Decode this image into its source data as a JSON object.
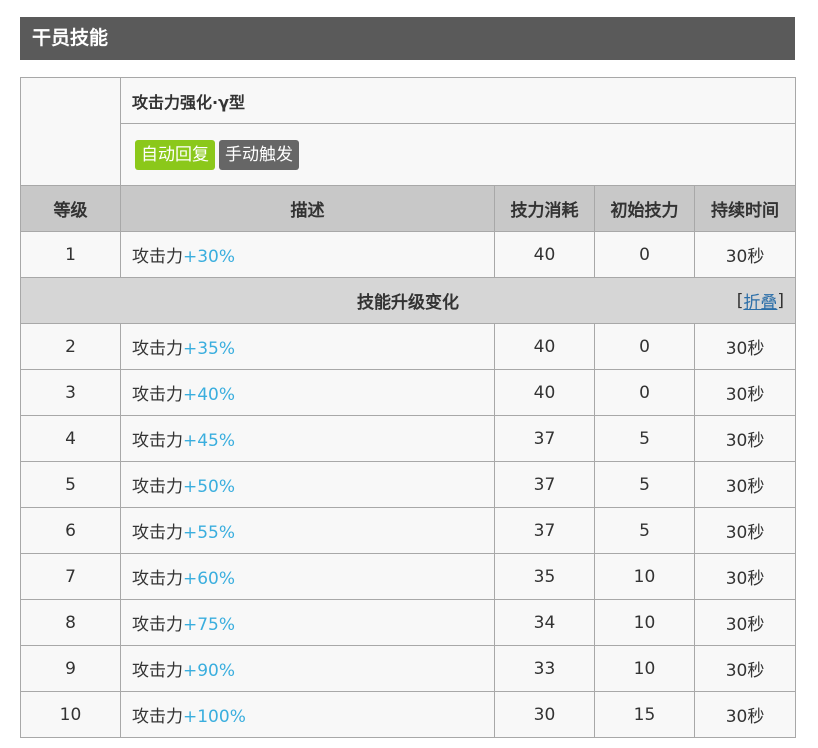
{
  "section": {
    "title": "干员技能"
  },
  "skill": {
    "name": "攻击力强化·γ型",
    "tags": [
      {
        "label": "自动回复",
        "color": "#8bc81a"
      },
      {
        "label": "手动触发",
        "color": "#666666"
      }
    ]
  },
  "columns": {
    "level": "等级",
    "description": "描述",
    "sp_cost": "技力消耗",
    "initial_sp": "初始技力",
    "duration": "持续时间"
  },
  "upgrade": {
    "title": "技能升级变化",
    "toggle_open": "[",
    "toggle_label": "折叠",
    "toggle_close": "]"
  },
  "rows": [
    {
      "level": "1",
      "desc_prefix": "攻击力",
      "desc_value": "+30%",
      "sp_cost": "40",
      "initial_sp": "0",
      "duration": "30秒"
    },
    {
      "level": "2",
      "desc_prefix": "攻击力",
      "desc_value": "+35%",
      "sp_cost": "40",
      "initial_sp": "0",
      "duration": "30秒"
    },
    {
      "level": "3",
      "desc_prefix": "攻击力",
      "desc_value": "+40%",
      "sp_cost": "40",
      "initial_sp": "0",
      "duration": "30秒"
    },
    {
      "level": "4",
      "desc_prefix": "攻击力",
      "desc_value": "+45%",
      "sp_cost": "37",
      "initial_sp": "5",
      "duration": "30秒"
    },
    {
      "level": "5",
      "desc_prefix": "攻击力",
      "desc_value": "+50%",
      "sp_cost": "37",
      "initial_sp": "5",
      "duration": "30秒"
    },
    {
      "level": "6",
      "desc_prefix": "攻击力",
      "desc_value": "+55%",
      "sp_cost": "37",
      "initial_sp": "5",
      "duration": "30秒"
    },
    {
      "level": "7",
      "desc_prefix": "攻击力",
      "desc_value": "+60%",
      "sp_cost": "35",
      "initial_sp": "10",
      "duration": "30秒"
    },
    {
      "level": "8",
      "desc_prefix": "攻击力",
      "desc_value": "+75%",
      "sp_cost": "34",
      "initial_sp": "10",
      "duration": "30秒"
    },
    {
      "level": "9",
      "desc_prefix": "攻击力",
      "desc_value": "+90%",
      "sp_cost": "33",
      "initial_sp": "10",
      "duration": "30秒"
    },
    {
      "level": "10",
      "desc_prefix": "攻击力",
      "desc_value": "+100%",
      "sp_cost": "30",
      "initial_sp": "15",
      "duration": "30秒"
    }
  ],
  "colors": {
    "header_bg": "#5a5a5a",
    "value_text": "#3aaede",
    "link": "#2b6ea8"
  }
}
